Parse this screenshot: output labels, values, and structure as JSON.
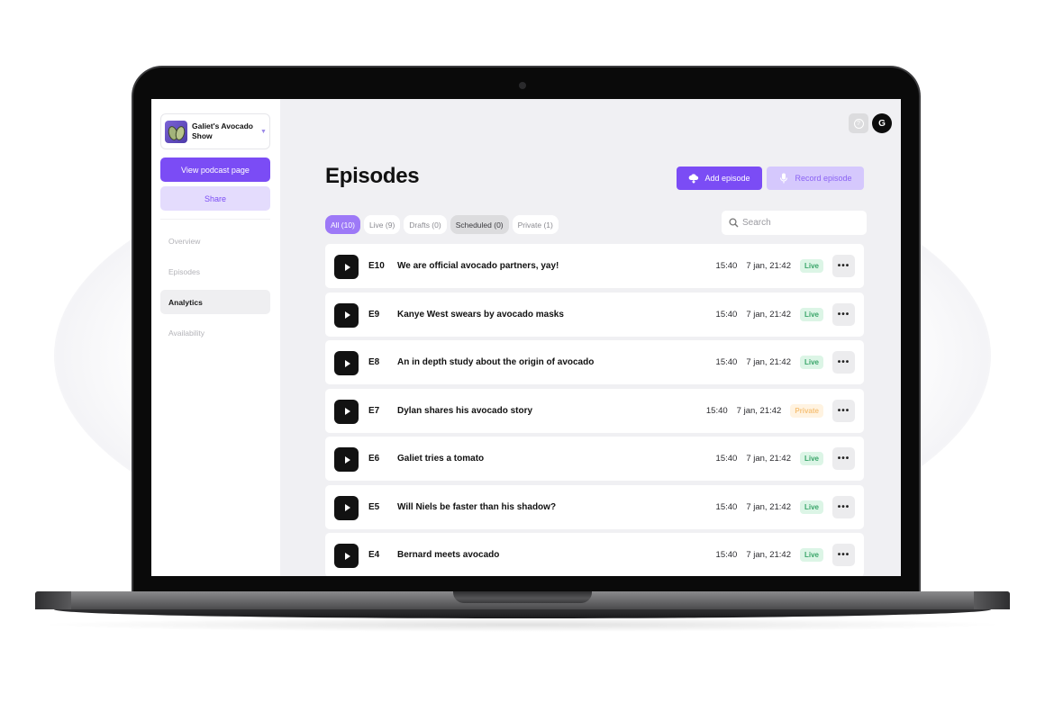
{
  "sidebar": {
    "podcast_name": "Galiet's Avocado Show",
    "view_button": "View podcast page",
    "share_button": "Share",
    "nav": [
      {
        "label": "Overview",
        "active": false
      },
      {
        "label": "Episodes",
        "active": false
      },
      {
        "label": "Analytics",
        "active": true
      },
      {
        "label": "Availability",
        "active": false
      }
    ]
  },
  "header": {
    "help_icon": "?",
    "avatar_initial": "G",
    "title": "Episodes",
    "add_button": "Add episode",
    "record_button": "Record episode"
  },
  "tabs": [
    {
      "label": "All (10)",
      "state": "active"
    },
    {
      "label": "Live (9)",
      "state": "normal"
    },
    {
      "label": "Drafts (0)",
      "state": "normal"
    },
    {
      "label": "Scheduled (0)",
      "state": "dim"
    },
    {
      "label": "Private (1)",
      "state": "normal"
    }
  ],
  "search": {
    "placeholder": "Search",
    "value": ""
  },
  "episodes": [
    {
      "number": "E10",
      "title": "We are official avocado partners, yay!",
      "duration": "15:40",
      "date": "7 jan, 21:42",
      "status": "Live"
    },
    {
      "number": "E9",
      "title": "Kanye West swears by avocado masks",
      "duration": "15:40",
      "date": "7 jan, 21:42",
      "status": "Live"
    },
    {
      "number": "E8",
      "title": "An in depth study about the origin of avocado",
      "duration": "15:40",
      "date": "7 jan, 21:42",
      "status": "Live"
    },
    {
      "number": "E7",
      "title": "Dylan shares his avocado story",
      "duration": "15:40",
      "date": "7 jan, 21:42",
      "status": "Private"
    },
    {
      "number": "E6",
      "title": "Galiet tries a tomato",
      "duration": "15:40",
      "date": "7 jan, 21:42",
      "status": "Live"
    },
    {
      "number": "E5",
      "title": "Will Niels be faster than his shadow?",
      "duration": "15:40",
      "date": "7 jan, 21:42",
      "status": "Live"
    },
    {
      "number": "E4",
      "title": "Bernard meets avocado",
      "duration": "15:40",
      "date": "7 jan, 21:42",
      "status": "Live"
    }
  ],
  "more_label": "•••",
  "colors": {
    "accent": "#7b4cf5",
    "accent_light": "#e4dcfd",
    "live": "#3aa56a",
    "private": "#f6c27a"
  }
}
